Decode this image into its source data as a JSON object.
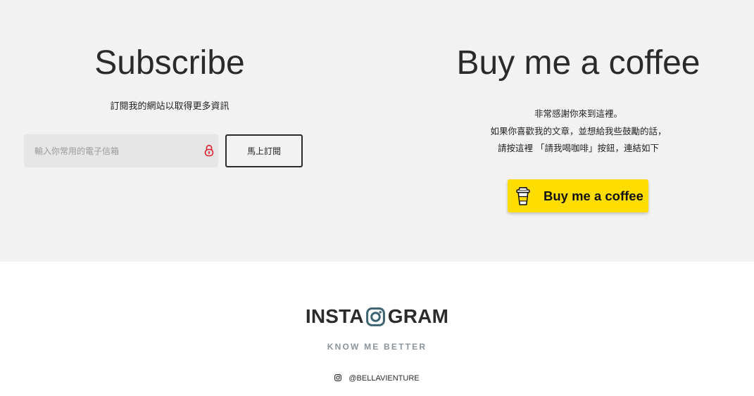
{
  "subscribe": {
    "title": "Subscribe",
    "subtitle": "訂閱我的網站以取得更多資訊",
    "email_placeholder": "輸入你常用的電子信箱",
    "button_label": "馬上訂閱",
    "lock_icon": "lock-icon",
    "lock_color": "#e0202e"
  },
  "coffee": {
    "title": "Buy me a coffee",
    "lines": [
      "非常感謝你來到這裡。",
      "如果你喜歡我的文章，並想給我些鼓勵的話，",
      "請按這裡 「請我喝咖啡」按鈕，連結如下"
    ],
    "button_label": "Buy me a coffee",
    "button_icon": "coffee-cup-icon",
    "button_color": "#ffdd00"
  },
  "instagram": {
    "title_left": "INSTA",
    "title_right": "GRAM",
    "title_icon": "instagram-icon",
    "icon_color": "#3d6470",
    "tagline": "KNOW ME BETTER",
    "handle": "@BELLAVIENTURE",
    "handle_icon": "instagram-small-icon"
  },
  "colors": {
    "top_band_bg": "#f2f2f2",
    "bottom_bg": "#ffffff",
    "text_dark": "#2b2b2b",
    "tagline_gray": "#8a949a"
  }
}
